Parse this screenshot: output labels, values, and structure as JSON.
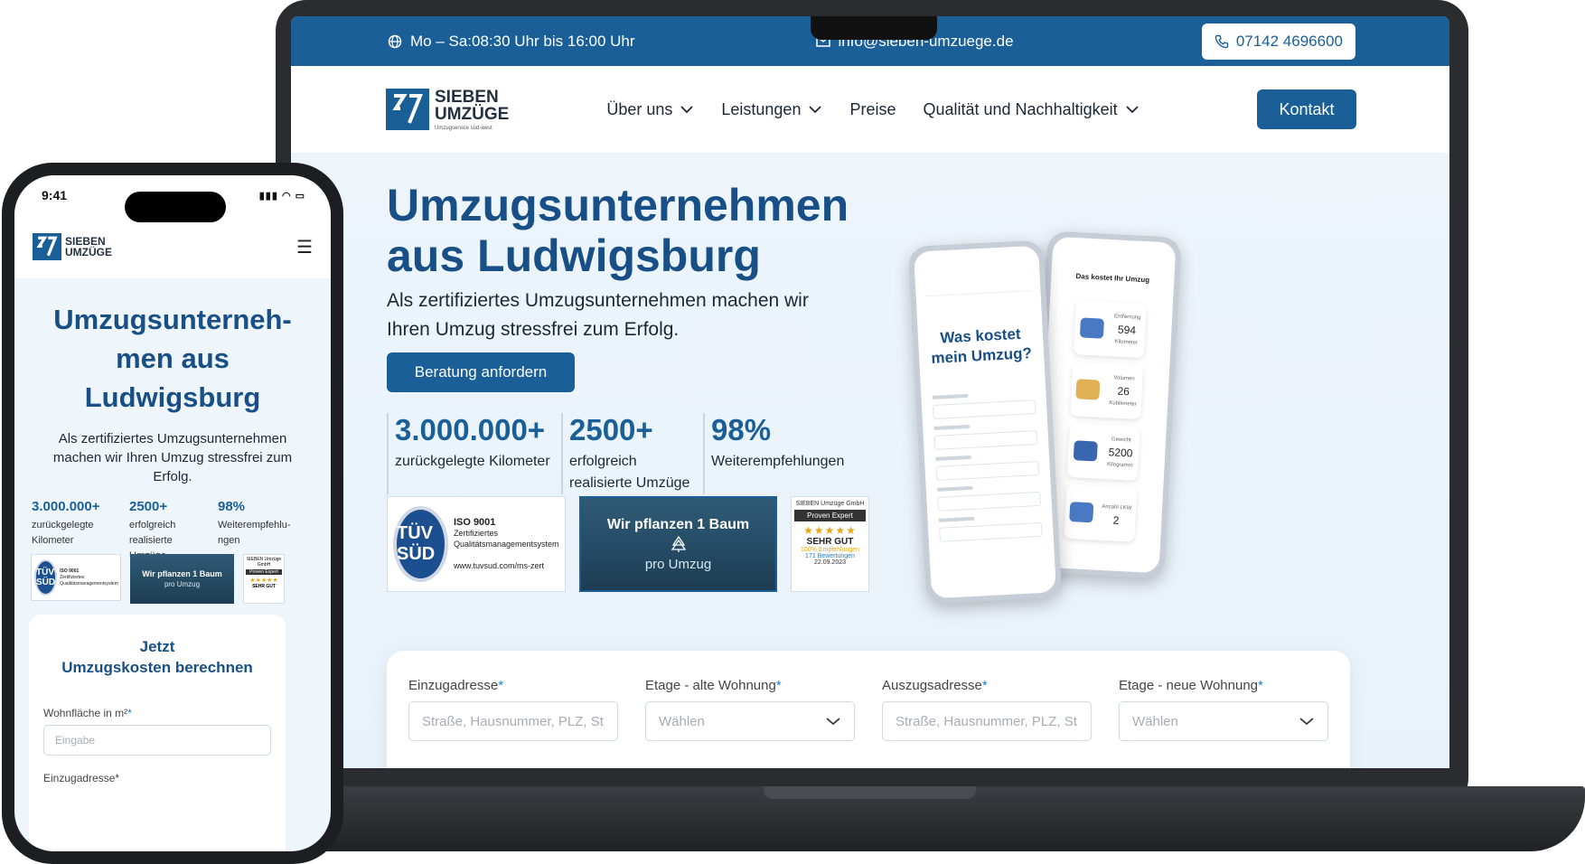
{
  "colors": {
    "brand": "#1b5f99",
    "heading": "#174f86",
    "accent_required": "#1b7fd1"
  },
  "laptop": {
    "topbar": {
      "hours_icon": "globe-icon",
      "hours": "Mo – Sa:08:30 Uhr bis 16:00 Uhr",
      "mail_icon": "mail-icon",
      "email": "info@sieben-umzuege.de",
      "phone_icon": "phone-icon",
      "phone": "07142 4696600"
    },
    "nav": {
      "logo_line1": "SIEBEN",
      "logo_line2": "UMZÜGE",
      "logo_tagline": "Umzugservice süd-west",
      "links": [
        "Über uns",
        "Leistungen",
        "Preise",
        "Qualität und Nachhaltigkeit"
      ],
      "kontakt": "Kontakt"
    },
    "hero": {
      "title_line1": "Umzugsunternehmen",
      "title_line2": "aus Ludwigsburg",
      "lead": "Als zertifiziertes Umzugsunternehmen machen wir Ihren Umzug stressfrei zum Erfolg.",
      "cta": "Beratung anfordern",
      "stats": [
        {
          "value": "3.000.000+",
          "label": "zurückgelegte Kilometer"
        },
        {
          "value": "2500+",
          "label": "erfolgreich realisierte Umzüge"
        },
        {
          "value": "98%",
          "label": "Weiterempfehlungen"
        }
      ]
    },
    "badges": {
      "tuv_seal": "TÜV SÜD",
      "tuv_title": "ISO 9001",
      "tuv_desc": "Zertifiziertes Qualitätsmanagementsystem",
      "tuv_url": "www.tuvsud.com/ms-zert",
      "tree_line1": "Wir pflanzen 1 Baum",
      "tree_line2": "pro Umzug",
      "pe_company": "SIEBEN Umzüge GmbH",
      "pe_brand": "Proven Expert",
      "pe_stars": "★★★★★",
      "pe_grade": "SEHR GUT",
      "pe_recommend": "100% Empfehlungen",
      "pe_reviews": "171 Bewertungen",
      "pe_date": "22.09.2023"
    },
    "form": {
      "fields": [
        {
          "label": "Einzugadresse",
          "placeholder": "Straße, Hausnummer, PLZ, St",
          "type": "input"
        },
        {
          "label": "Etage - alte Wohnung",
          "placeholder": "Wählen",
          "type": "select"
        },
        {
          "label": "Auszugsadresse",
          "placeholder": "Straße, Hausnummer, PLZ, St",
          "type": "input"
        },
        {
          "label": "Etage - neue Wohnung",
          "placeholder": "Wählen",
          "type": "select"
        }
      ],
      "required_mark": "*"
    },
    "mockup_phones": {
      "front_title_line1": "Was kostet",
      "front_title_line2": "mein Umzug?",
      "back_title": "Das kostet Ihr Umzug",
      "cards": [
        {
          "label": "Entfernung",
          "value": "594",
          "unit": "Kilometer"
        },
        {
          "label": "Volumen",
          "value": "26",
          "unit": "Kubikmeter"
        },
        {
          "label": "Gewicht",
          "value": "5200",
          "unit": "Kilogramm"
        },
        {
          "label": "Anzahl LKW",
          "value": "2",
          "unit": ""
        }
      ]
    }
  },
  "phone": {
    "time": "9:41",
    "logo_line1": "SIEBEN",
    "logo_line2": "UMZÜGE",
    "title_line1": "Umzugsunterneh-",
    "title_line2": "men aus",
    "title_line3": "Ludwigsburg",
    "lead": "Als zertifiziertes Umzugsunternehmen machen wir Ihren Umzug stressfrei zum Erfolg.",
    "stats": [
      {
        "value": "3.000.000+",
        "label": "zurückgelegte Kilometer"
      },
      {
        "value": "2500+",
        "label": "erfolgreich realisierte Umzüge"
      },
      {
        "value": "98%",
        "label": "Weiterempfehlu-ngen"
      }
    ],
    "card_title_line1": "Jetzt",
    "card_title_line2": "Umzugskosten berechnen",
    "field_label": "Wohnfläche in m²",
    "field_placeholder": "Eingabe",
    "next_label": "Einzugadresse"
  }
}
